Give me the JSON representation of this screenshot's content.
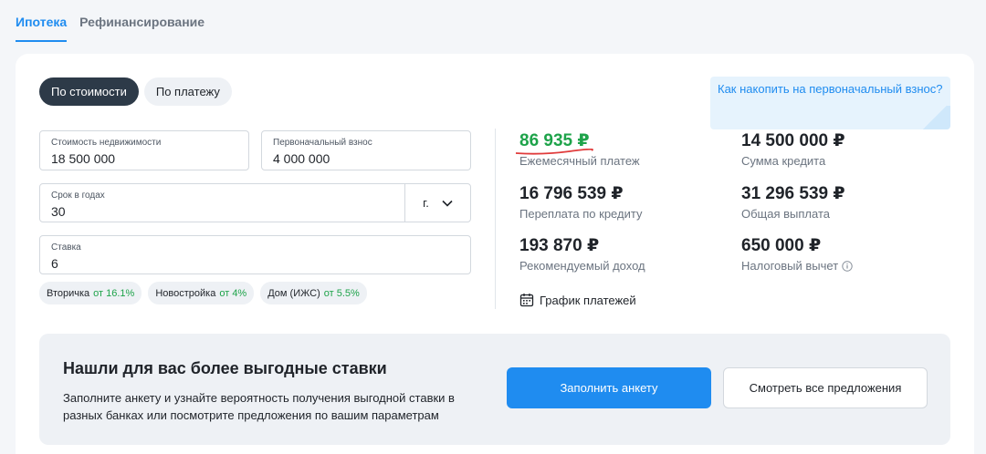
{
  "tabs": [
    {
      "label": "Ипотека",
      "active": true
    },
    {
      "label": "Рефинансирование",
      "active": false
    }
  ],
  "mode_toggle": [
    {
      "label": "По стоимости",
      "active": true
    },
    {
      "label": "По платежу",
      "active": false
    }
  ],
  "fields": {
    "property_cost": {
      "label": "Стоимость недвижимости",
      "value": "18 500 000"
    },
    "down_payment": {
      "label": "Первоначальный взнос",
      "value": "4 000 000"
    },
    "term": {
      "label": "Срок в годах",
      "value": "30",
      "unit": "г."
    },
    "rate": {
      "label": "Ставка",
      "value": "6"
    }
  },
  "chips": [
    {
      "label": "Вторичка",
      "rate": "от 16.1%"
    },
    {
      "label": "Новостройка",
      "rate": "от 4%"
    },
    {
      "label": "Дом (ИЖС)",
      "rate": "от 5.5%"
    }
  ],
  "results": {
    "monthly_payment": {
      "value": "86 935 ₽",
      "caption": "Ежемесячный платеж"
    },
    "loan_amount": {
      "value": "14 500 000 ₽",
      "caption": "Сумма кредита"
    },
    "overpayment": {
      "value": "16 796 539 ₽",
      "caption": "Переплата по кредиту"
    },
    "total_payment": {
      "value": "31 296 539 ₽",
      "caption": "Общая выплата"
    },
    "recommended_income": {
      "value": "193 870 ₽",
      "caption": "Рекомендуемый доход"
    },
    "tax_deduction": {
      "value": "650 000 ₽",
      "caption": "Налоговый вычет"
    }
  },
  "schedule_link": "График платежей",
  "promo": "Как накопить на первоначальный взнос?",
  "banner": {
    "title": "Нашли для вас более выгодные ставки",
    "text": "Заполните анкету и узнайте вероятность получения выгодной ставки в разных банках или посмотрите предложения по вашим параметрам",
    "primary_button": "Заполнить анкету",
    "secondary_button": "Смотреть все предложения"
  },
  "icons": {
    "chevron": "chevron-down-icon",
    "info": "info-icon",
    "calendar": "calendar-icon"
  },
  "colors": {
    "accent": "#1f8cf0",
    "active_toggle": "#2d3a48",
    "green": "#1ea34a",
    "underline_red": "#e03b3b"
  }
}
